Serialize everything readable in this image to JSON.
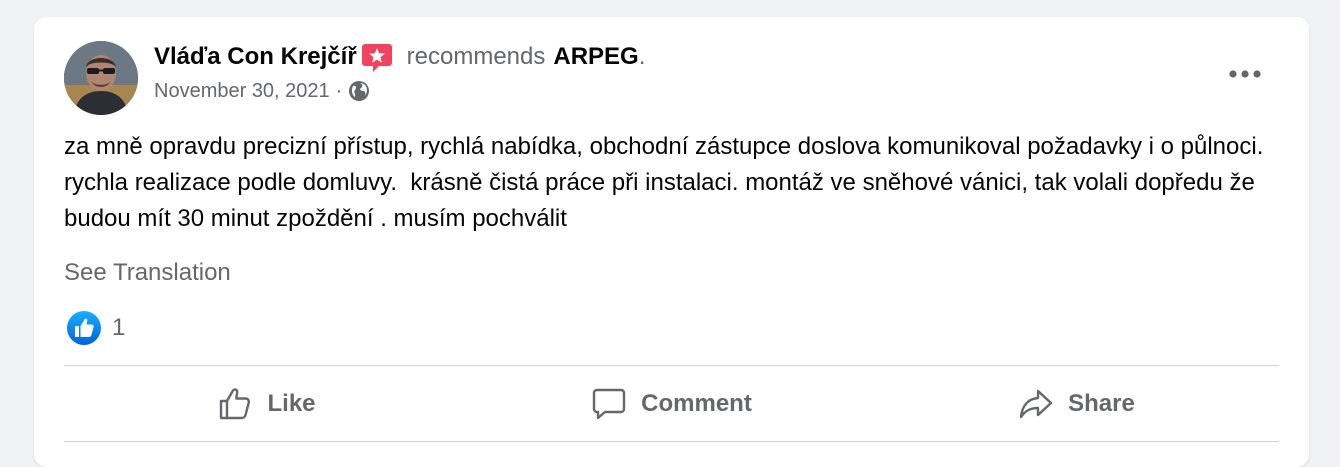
{
  "post": {
    "author": "Vláďa Con Krejčíř",
    "recommends_text": "recommends",
    "page_name": "ARPEG",
    "page_suffix": ".",
    "date": "November 30, 2021",
    "date_sep": "·",
    "body": "za mně opravdu precizní přístup, rychlá nabídka, obchodní zástupce doslova komunikoval požadavky i o půlnoci. rychla realizace podle domluvy.  krásně čistá práce při instalaci. montáž ve sněhové vánici, tak volali dopředu že budou mít 30 minut zpoždění . musím pochválit",
    "see_translation": "See Translation",
    "reaction_count": "1"
  },
  "actions": {
    "like": "Like",
    "comment": "Comment",
    "share": "Share"
  },
  "icons": {
    "recommend_badge": "recommend-badge-icon",
    "audience": "globe-icon",
    "more": "more-options-icon",
    "reaction": "like-reaction-icon",
    "like": "thumbs-up-icon",
    "comment": "comment-bubble-icon",
    "share": "share-arrow-icon"
  },
  "colors": {
    "badge": "#f3425f",
    "like_blue": "#1877f2",
    "text_primary": "#050505",
    "text_secondary": "#65676b"
  }
}
